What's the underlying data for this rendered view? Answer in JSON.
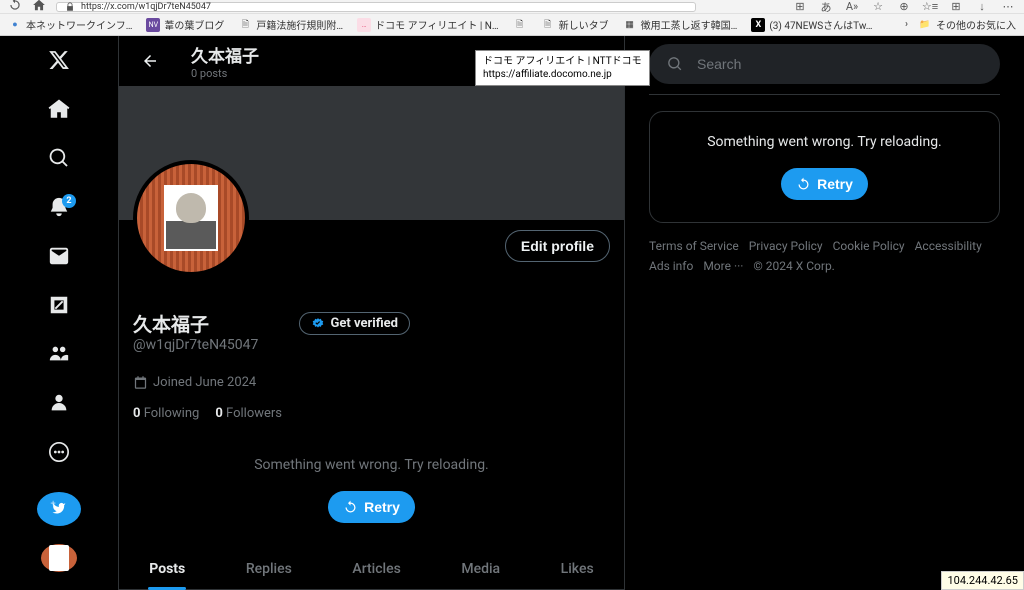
{
  "browser": {
    "url": "https://x.com/w1qjDr7teN45047",
    "bookmarks": [
      {
        "label": "本ネットワークインフ…",
        "color": "#4082d1"
      },
      {
        "label": "葦の葉ブログ",
        "color": "#6a4a9f",
        "prefix": "NV"
      },
      {
        "label": "戸籍法施行規則附…",
        "color": ""
      },
      {
        "label": "ドコモ アフィリエイト | N…",
        "color": "#e43b6a",
        "prefix": "…"
      },
      {
        "label": "",
        "color": ""
      },
      {
        "label": "新しいタブ",
        "color": ""
      },
      {
        "label": "徴用工蒸し返す韓国…",
        "color": ""
      },
      {
        "label": "(3) 47NEWSさんはTw…",
        "color": "#000",
        "prefix": "X"
      }
    ],
    "other_bookmarks": "その他のお気に入"
  },
  "tooltip": {
    "line1": "ドコモ アフィリエイト | NTTドコモ",
    "line2": "https://affiliate.docomo.ne.jp"
  },
  "nav_badge": "2",
  "profile": {
    "header_name": "久本福子",
    "posts_count": "0 posts",
    "display_name": "久本福子",
    "handle": "@w1qjDr7teN45047",
    "joined": "Joined June 2024",
    "following_count": "0",
    "following_label": "Following",
    "followers_count": "0",
    "followers_label": "Followers",
    "verify_btn": "Get verified",
    "edit_btn": "Edit profile"
  },
  "tabs": [
    "Posts",
    "Replies",
    "Articles",
    "Media",
    "Likes"
  ],
  "error": {
    "msg": "Something went wrong. Try reloading.",
    "retry": "Retry"
  },
  "search": {
    "placeholder": "Search"
  },
  "footer": {
    "links": [
      "Terms of Service",
      "Privacy Policy",
      "Cookie Policy",
      "Accessibility",
      "Ads info",
      "More ···"
    ],
    "copyright": "© 2024 X Corp."
  },
  "ip": "104.244.42.65"
}
